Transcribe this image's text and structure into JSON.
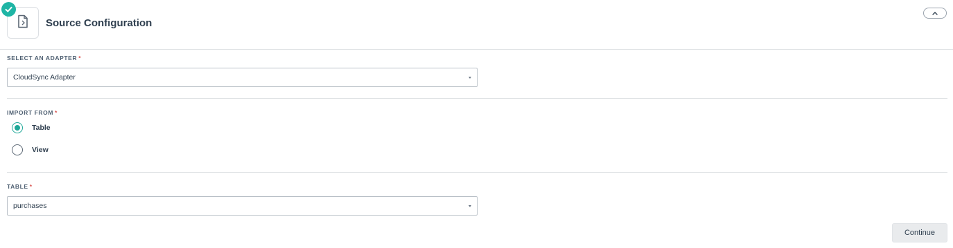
{
  "header": {
    "title": "Source Configuration",
    "status_icon": "check-circle-icon",
    "step_icon": "file-source-icon",
    "collapse_icon": "chevron-up-icon"
  },
  "adapter": {
    "label": "SELECT AN ADAPTER",
    "required_marker": "*",
    "selected": "CloudSync Adapter"
  },
  "import_from": {
    "label": "IMPORT FROM",
    "required_marker": "*",
    "options": [
      {
        "label": "Table",
        "checked": true
      },
      {
        "label": "View",
        "checked": false
      }
    ]
  },
  "table": {
    "label": "TABLE",
    "required_marker": "*",
    "selected": "purchases"
  },
  "actions": {
    "continue_label": "Continue"
  },
  "colors": {
    "accent": "#1fb5a5",
    "required": "#d9534f",
    "text": "#2f3f4f",
    "label": "#4f6072"
  }
}
